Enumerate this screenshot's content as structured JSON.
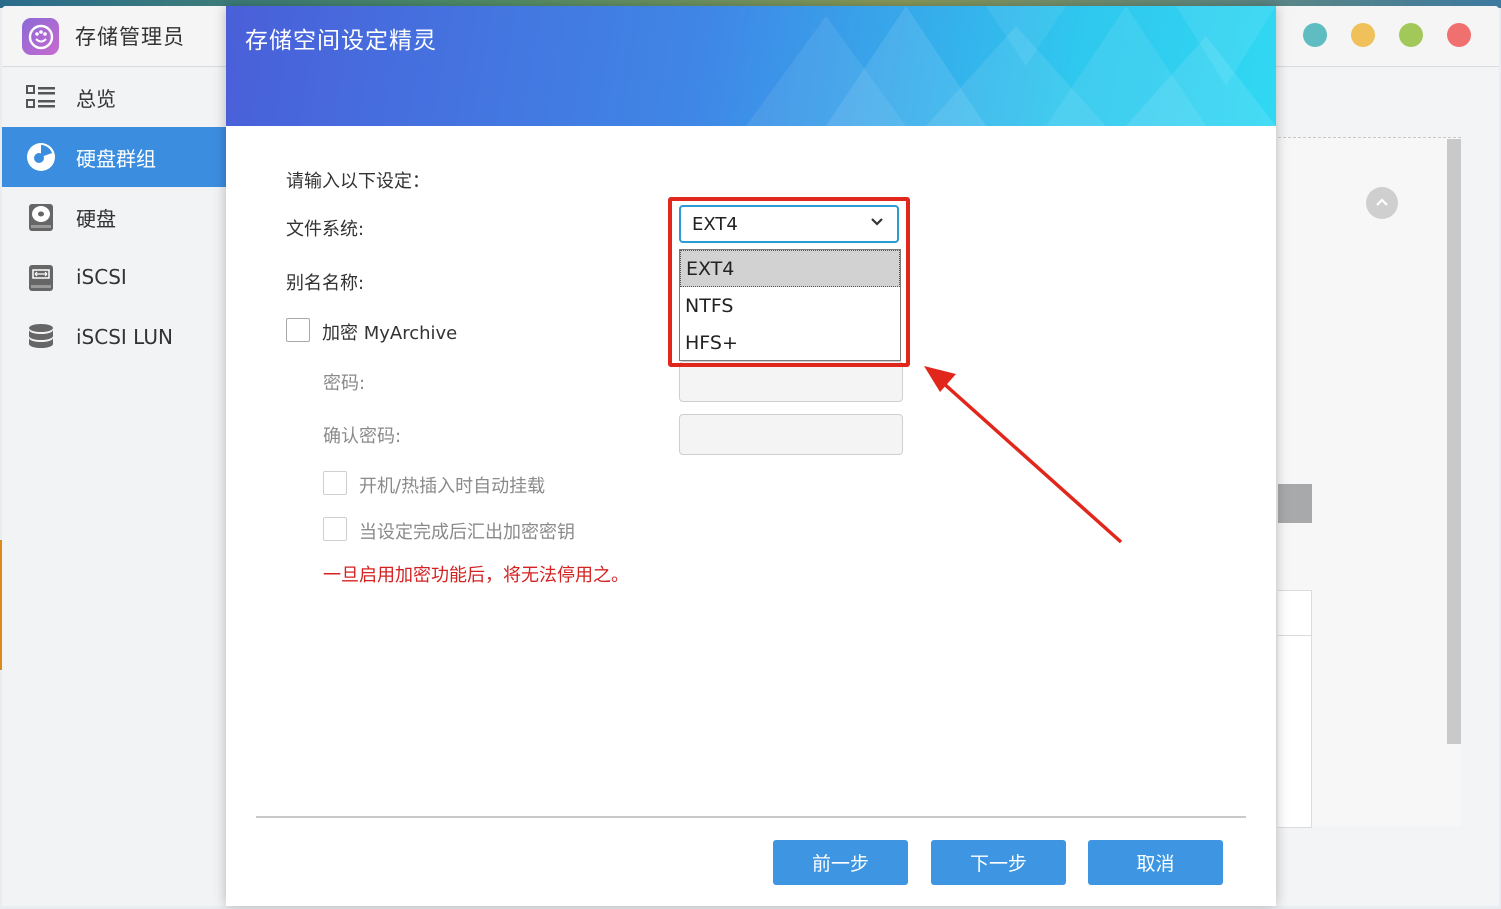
{
  "app": {
    "title": "存储管理员",
    "window_controls": [
      "#5fbcc0",
      "#f0c05a",
      "#a3c85a",
      "#f07070"
    ]
  },
  "sidebar": {
    "items": [
      {
        "label": "总览",
        "icon": "overview-list-icon",
        "active": false
      },
      {
        "label": "硬盘群组",
        "icon": "disk-group-icon",
        "active": true
      },
      {
        "label": "硬盘",
        "icon": "hard-disk-icon",
        "active": false
      },
      {
        "label": "iSCSI",
        "icon": "iscsi-icon",
        "active": false
      },
      {
        "label": "iSCSI LUN",
        "icon": "database-icon",
        "active": false
      }
    ]
  },
  "dialog": {
    "title": "存储空间设定精灵",
    "intro": "请输入以下设定：",
    "filesystem_label": "文件系统:",
    "filesystem_value": "EXT4",
    "filesystem_options": [
      "EXT4",
      "NTFS",
      "HFS+"
    ],
    "alias_label": "别名名称:",
    "encrypt_label": "加密 MyArchive",
    "password_label": "密码:",
    "confirm_password_label": "确认密码:",
    "automount_label": "开机/热插入时自动挂载",
    "export_key_label": "当设定完成后汇出加密密钥",
    "warning": "一旦启用加密功能后，将无法停用之。",
    "buttons": {
      "prev": "前一步",
      "next": "下一步",
      "cancel": "取消"
    }
  },
  "annotation": {
    "highlight_color": "#e1261c",
    "arrow_color": "#e1261c"
  },
  "colors": {
    "accent": "#3e96e2",
    "sidebar_active": "#3b8de0",
    "warning": "#d42222"
  }
}
